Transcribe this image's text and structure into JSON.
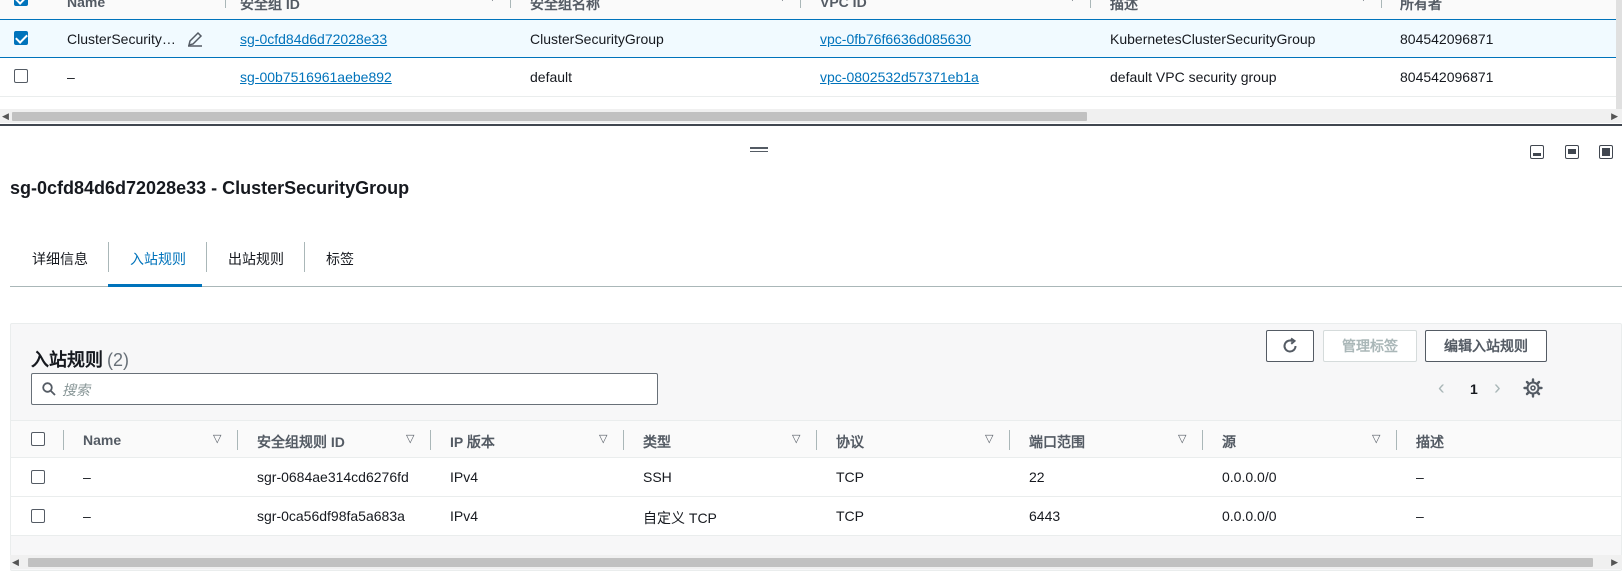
{
  "top_table": {
    "columns": [
      "Name",
      "安全组 ID",
      "安全组名称",
      "VPC ID",
      "描述",
      "所有者"
    ],
    "rows": [
      {
        "name": "ClusterSecurity…",
        "sg_id": "sg-0cfd84d6d72028e33",
        "sg_name": "ClusterSecurityGroup",
        "vpc_id": "vpc-0fb76f6636d085630",
        "description": "KubernetesClusterSecurityGroup",
        "owner": "804542096871",
        "selected": true
      },
      {
        "name": "–",
        "sg_id": "sg-00b7516961aebe892",
        "sg_name": "default",
        "vpc_id": "vpc-0802532d57371eb1a",
        "description": "default VPC security group",
        "owner": "804542096871",
        "selected": false
      }
    ],
    "scrollbar_position": 0.68
  },
  "detail": {
    "title": "sg-0cfd84d6d72028e33 - ClusterSecurityGroup",
    "tabs": [
      {
        "label": "详细信息",
        "active": false
      },
      {
        "label": "入站规则",
        "active": true
      },
      {
        "label": "出站规则",
        "active": false
      },
      {
        "label": "标签",
        "active": false
      }
    ]
  },
  "rules": {
    "title": "入站规则",
    "count": "(2)",
    "buttons": {
      "refresh": "refresh-icon",
      "manage_tags": "管理标签",
      "edit_rules": "编辑入站规则"
    },
    "search": {
      "placeholder": "搜索",
      "value": ""
    },
    "pagination": {
      "page": "1"
    },
    "columns": [
      "Name",
      "安全组规则 ID",
      "IP 版本",
      "类型",
      "协议",
      "端口范围",
      "源",
      "描述"
    ],
    "rows": [
      {
        "name": "–",
        "rule_id": "sgr-0684ae314cd6276fd",
        "ip_version": "IPv4",
        "type": "SSH",
        "protocol": "TCP",
        "port_range": "22",
        "source": "0.0.0.0/0",
        "description": "–"
      },
      {
        "name": "–",
        "rule_id": "sgr-0ca56df98fa5a683a",
        "ip_version": "IPv4",
        "type": "自定义 TCP",
        "protocol": "TCP",
        "port_range": "6443",
        "source": "0.0.0.0/0",
        "description": "–"
      }
    ]
  },
  "colors": {
    "accent": "#0073bb",
    "text": "#16191f",
    "muted": "#545b64"
  }
}
